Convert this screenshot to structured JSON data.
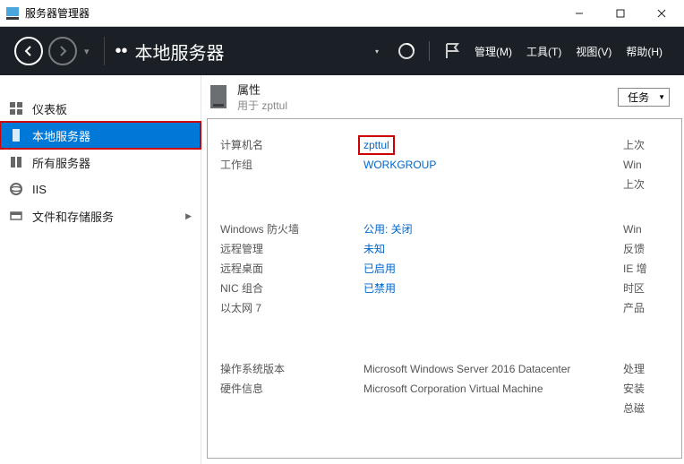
{
  "window": {
    "title": "服务器管理器"
  },
  "ribbon": {
    "dotdot": "••",
    "page_title": "本地服务器",
    "menu_manage": "管理(M)",
    "menu_tools": "工具(T)",
    "menu_view": "视图(V)",
    "menu_help": "帮助(H)"
  },
  "sidebar": {
    "items": [
      {
        "label": "仪表板"
      },
      {
        "label": "本地服务器"
      },
      {
        "label": "所有服务器"
      },
      {
        "label": "IIS"
      },
      {
        "label": "文件和存储服务"
      }
    ]
  },
  "properties": {
    "heading": "属性",
    "subheading": "用于 zpttul",
    "tasks_label": "任务",
    "rows1": [
      {
        "label": "计算机名",
        "value": "zpttul",
        "right": "上次"
      },
      {
        "label": "工作组",
        "value": "WORKGROUP",
        "right": "Win"
      },
      {
        "label": "",
        "value": "",
        "right": "上次"
      }
    ],
    "rows2": [
      {
        "label": "Windows 防火墙",
        "value": "公用: 关闭",
        "right": "Win"
      },
      {
        "label": "远程管理",
        "value": "未知",
        "right": "反馈"
      },
      {
        "label": "远程桌面",
        "value": "已启用",
        "right": "IE 增"
      },
      {
        "label": "NIC 组合",
        "value": "已禁用",
        "right": "时区"
      },
      {
        "label": "以太网 7",
        "value": "",
        "right": "产品"
      }
    ],
    "rows3": [
      {
        "label": "操作系统版本",
        "value": "Microsoft Windows Server 2016 Datacenter",
        "right": "处理"
      },
      {
        "label": "硬件信息",
        "value": "Microsoft Corporation Virtual Machine",
        "right": "安装"
      },
      {
        "label": "",
        "value": "",
        "right": "总磁"
      }
    ]
  }
}
